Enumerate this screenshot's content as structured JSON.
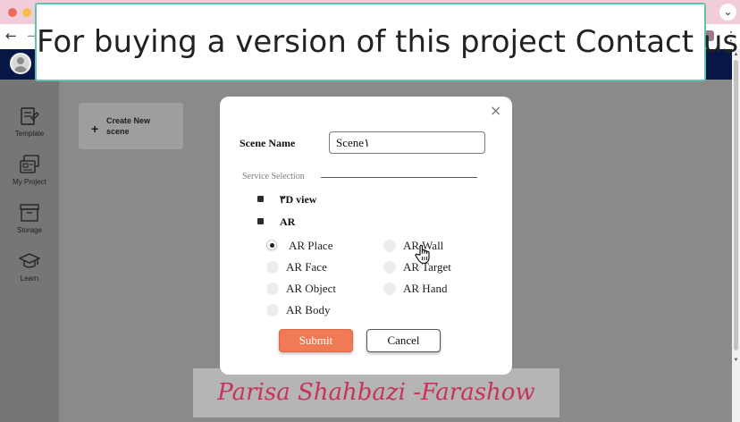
{
  "banner": {
    "text": "For buying a version of this project Contact us"
  },
  "sidebar": {
    "items": [
      {
        "label": "Template",
        "icon": "template-icon"
      },
      {
        "label": "My Project",
        "icon": "my-project-icon"
      },
      {
        "label": "Storage",
        "icon": "storage-icon"
      },
      {
        "label": "Learn",
        "icon": "learn-icon"
      }
    ]
  },
  "main": {
    "create_card": {
      "plus": "+",
      "label": "Create New scene"
    }
  },
  "modal": {
    "close": "×",
    "scene_name_label": "Scene Name",
    "scene_name_value": "Scene١",
    "service_label": "Service Selection",
    "checks": [
      {
        "label": "٣D view"
      },
      {
        "label": "AR"
      }
    ],
    "radios": [
      {
        "label": "AR Place",
        "selected": true
      },
      {
        "label": "AR Wall",
        "selected": false
      },
      {
        "label": "AR Face",
        "selected": false
      },
      {
        "label": "AR Target",
        "selected": false
      },
      {
        "label": "AR Object",
        "selected": false
      },
      {
        "label": "AR Hand",
        "selected": false
      },
      {
        "label": "AR Body",
        "selected": false
      }
    ],
    "submit_label": "Submit",
    "cancel_label": "Cancel"
  },
  "watermark": {
    "text": "Parisa Shahbazi -Farashow"
  },
  "colors": {
    "header_bg": "#061645",
    "submit_bg": "#ef7a55",
    "banner_border": "#60c2b0",
    "watermark_text": "#c8325b"
  }
}
